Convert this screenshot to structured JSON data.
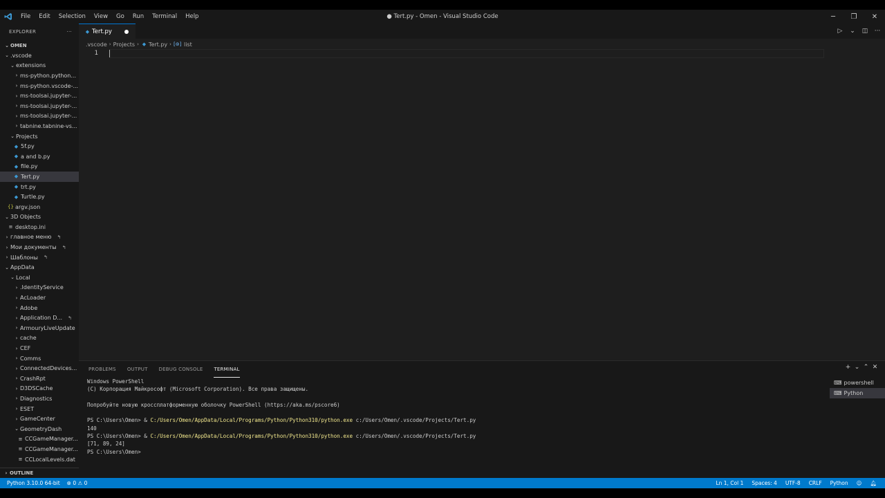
{
  "window": {
    "title": "● Tert.py - Omen - Visual Studio Code"
  },
  "menu": [
    "File",
    "Edit",
    "Selection",
    "View",
    "Go",
    "Run",
    "Terminal",
    "Help"
  ],
  "explorer": {
    "header": "EXPLORER",
    "more": "···",
    "root": "OMEN",
    "items": [
      {
        "label": ".vscode",
        "chev": "⌄"
      },
      {
        "label": "extensions",
        "chev": "⌄"
      },
      {
        "label": "ms-python.python...",
        "chev": "›"
      },
      {
        "label": "ms-python.vscode-...",
        "chev": "›"
      },
      {
        "label": "ms-toolsai.jupyter-...",
        "chev": "›"
      },
      {
        "label": "ms-toolsai.jupyter-...",
        "chev": "›"
      },
      {
        "label": "ms-toolsai.jupyter-...",
        "chev": "›"
      },
      {
        "label": "tabnine.tabnine-vs...",
        "chev": "›"
      },
      {
        "label": "Projects",
        "chev": "⌄"
      },
      {
        "label": "5f.py",
        "icon": "python"
      },
      {
        "label": "a and b.py",
        "icon": "python"
      },
      {
        "label": "file.py",
        "icon": "python"
      },
      {
        "label": "Tert.py",
        "icon": "python"
      },
      {
        "label": "trt.py",
        "icon": "python"
      },
      {
        "label": "Turtle.py",
        "icon": "python"
      },
      {
        "label": "argv.json",
        "icon": "json"
      },
      {
        "label": "3D Objects",
        "chev": "⌄"
      },
      {
        "label": "desktop.ini",
        "icon": "ini"
      },
      {
        "label": "главное меню",
        "chev": "›",
        "link": "↰"
      },
      {
        "label": "Мои документы",
        "chev": "›",
        "link": "↰"
      },
      {
        "label": "Шаблоны",
        "chev": "›",
        "link": "↰"
      },
      {
        "label": "AppData",
        "chev": "⌄"
      },
      {
        "label": "Local",
        "chev": "⌄"
      },
      {
        "label": ".IdentityService",
        "chev": "›"
      },
      {
        "label": "AcLoader",
        "chev": "›"
      },
      {
        "label": "Adobe",
        "chev": "›"
      },
      {
        "label": "Application D...",
        "chev": "›",
        "link": "↰"
      },
      {
        "label": "ArmouryLiveUpdate",
        "chev": "›"
      },
      {
        "label": "cache",
        "chev": "›"
      },
      {
        "label": "CEF",
        "chev": "›"
      },
      {
        "label": "Comms",
        "chev": "›"
      },
      {
        "label": "ConnectedDevices...",
        "chev": "›"
      },
      {
        "label": "CrashRpt",
        "chev": "›"
      },
      {
        "label": "D3DSCache",
        "chev": "›"
      },
      {
        "label": "Diagnostics",
        "chev": "›"
      },
      {
        "label": "ESET",
        "chev": "›"
      },
      {
        "label": "GameCenter",
        "chev": "›"
      },
      {
        "label": "GeometryDash",
        "chev": "⌄"
      },
      {
        "label": "CCGameManager...",
        "icon": "file"
      },
      {
        "label": "CCGameManager...",
        "icon": "file"
      },
      {
        "label": "CCLocalLevels.dat",
        "icon": "file"
      }
    ],
    "outline": "OUTLINE"
  },
  "editor": {
    "tab": "Tert.py",
    "breadcrumb": [
      ".vscode",
      "Projects",
      "Tert.py",
      "list"
    ],
    "line_number": "1"
  },
  "panel": {
    "tabs": [
      "PROBLEMS",
      "OUTPUT",
      "DEBUG CONSOLE",
      "TERMINAL"
    ],
    "terminal_lines": [
      {
        "text": "Windows PowerShell"
      },
      {
        "text": "(C) Корпорация Майкрософт (Microsoft Corporation). Все права защищены."
      },
      {
        "text": ""
      },
      {
        "text": "Попробуйте новую кроссплатформенную оболочку PowerShell (https://aka.ms/pscore6)"
      },
      {
        "text": ""
      },
      {
        "pre": "PS C:\\Users\\Omen> & ",
        "hl": "C:/Users/Omen/AppData/Local/Programs/Python/Python310/python.exe",
        "post": " c:/Users/Omen/.vscode/Projects/Tert.py"
      },
      {
        "text": "140"
      },
      {
        "pre": "PS C:\\Users\\Omen> & ",
        "hl": "C:/Users/Omen/AppData/Local/Programs/Python/Python310/python.exe",
        "post": " c:/Users/Omen/.vscode/Projects/Tert.py"
      },
      {
        "text": "[71, 89, 24]"
      },
      {
        "text": "PS C:\\Users\\Omen>"
      }
    ],
    "terminals": [
      "powershell",
      "Python"
    ]
  },
  "status": {
    "python": "Python 3.10.0 64-bit",
    "problems": "⊗ 0 ⚠ 0",
    "position": "Ln 1, Col 1",
    "spaces": "Spaces: 4",
    "encoding": "UTF-8",
    "eol": "CRLF",
    "language": "Python"
  }
}
